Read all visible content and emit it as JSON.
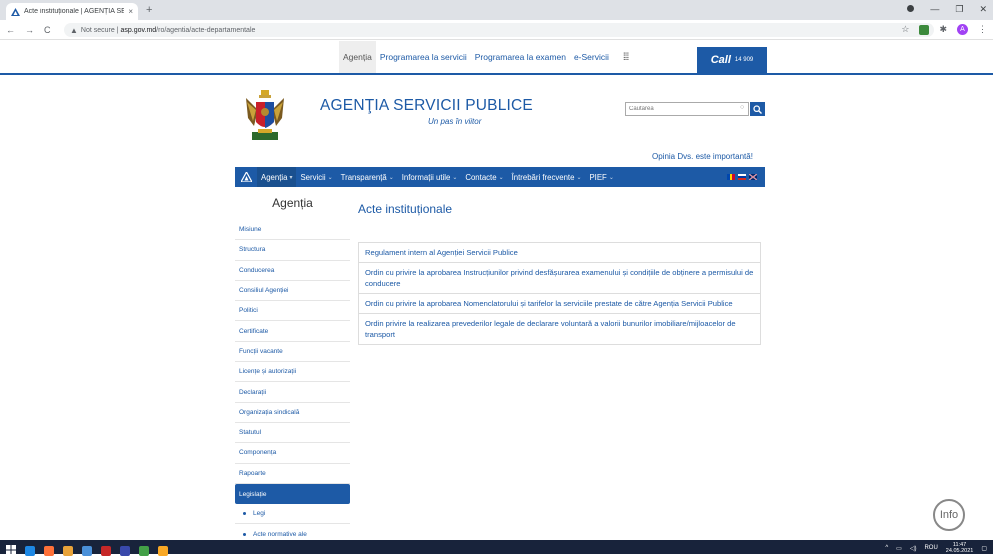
{
  "browser": {
    "tab_title": "Acte instituționale | AGENȚIA SE",
    "tab_close": "×",
    "new_tab": "+",
    "back": "←",
    "forward": "→",
    "reload": "C",
    "security_label": "Not secure",
    "url_host": "asp.gov.md",
    "url_path": "/ro/agentia/acte-departamentale",
    "window_controls": [
      "—",
      "❐",
      "✕"
    ],
    "profile_initial": "A"
  },
  "topnav": {
    "items": [
      "Agenția",
      "Programarea la servicii",
      "Programarea la examen",
      "e-Servicii"
    ],
    "active_index": 0,
    "apps_glyph": "⁞⁞⁞",
    "call_label": "Call",
    "call_number": "14 909"
  },
  "header": {
    "title": "AGENŢIA SERVICII PUBLICE",
    "slogan": "Un pas în viitor",
    "search_placeholder": "Căutarea",
    "search_clear": "○",
    "opinion": "Opinia Dvs. este importantă!"
  },
  "mainnav": {
    "items": [
      {
        "label": "Agenția",
        "caret": "▾"
      },
      {
        "label": "Servicii",
        "caret": "⌄"
      },
      {
        "label": "Transparență",
        "caret": "⌄"
      },
      {
        "label": "Informații utile",
        "caret": "⌄"
      },
      {
        "label": "Contacte",
        "caret": "⌄"
      },
      {
        "label": "Întrebări frecvente",
        "caret": "⌄"
      },
      {
        "label": "PIEF",
        "caret": "⌄"
      }
    ]
  },
  "sidebar": {
    "heading": "Agenția",
    "items": [
      "Misiune",
      "Structura",
      "Conducerea",
      "Consiliul Agenției",
      "Politici",
      "Certificate",
      "Funcții vacante",
      "Licențe și autorizații",
      "Declarații",
      "Organizația sindicală",
      "Statutul",
      "Componența",
      "Rapoarte",
      "Legislație"
    ],
    "active_index": 13,
    "subitems": [
      "Legi",
      "Acte normative ale"
    ]
  },
  "content": {
    "title": "Acte instituționale",
    "documents": [
      "Regulament intern al Agenției Servicii Publice",
      "Ordin cu privire la aprobarea Instrucțiunilor privind desfășurarea examenului și condițiile de obținere a permisului de conducere",
      "Ordin cu privire la aprobarea Nomenclatorului și tarifelor la serviciile prestate de către Agenția Servicii Publice",
      "Ordin privire la realizarea prevederilor legale de declarare voluntară a valorii bunurilor imobiliare/mijloacelor de transport"
    ]
  },
  "info_button": "Info",
  "taskbar": {
    "lang": "ROU",
    "time": "11:47",
    "date": "24.05.2021"
  },
  "colors": {
    "brand_blue": "#1d5aa6",
    "taskbar": "#18233b"
  }
}
